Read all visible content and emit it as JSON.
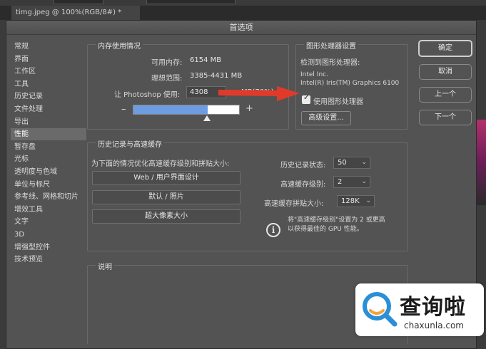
{
  "window": {
    "doc_tab": "timg.jpeg @ 100%(RGB/8#) *",
    "title": "首选项"
  },
  "sidebar": {
    "items": [
      {
        "label": "常规",
        "active": false
      },
      {
        "label": "界面",
        "active": false
      },
      {
        "label": "工作区",
        "active": false
      },
      {
        "label": "工具",
        "active": false
      },
      {
        "label": "历史记录",
        "active": false
      },
      {
        "label": "文件处理",
        "active": false
      },
      {
        "label": "导出",
        "active": false
      },
      {
        "label": "性能",
        "active": true
      },
      {
        "label": "暂存盘",
        "active": false
      },
      {
        "label": "光标",
        "active": false
      },
      {
        "label": "透明度与色域",
        "active": false
      },
      {
        "label": "单位与标尺",
        "active": false
      },
      {
        "label": "参考线、网格和切片",
        "active": false
      },
      {
        "label": "增效工具",
        "active": false
      },
      {
        "label": "文字",
        "active": false
      },
      {
        "label": "3D",
        "active": false
      },
      {
        "label": "增强型控件",
        "active": false
      },
      {
        "label": "技术预览",
        "active": false
      }
    ]
  },
  "memory": {
    "title": "内存使用情况",
    "available_label": "可用内存:",
    "available_value": "6154 MB",
    "range_label": "理想范围:",
    "range_value": "3385-4431 MB",
    "let_label": "让 Photoshop 使用:",
    "use_value": "4308",
    "unit": "MB(70%)",
    "minus": "–",
    "plus": "+",
    "slider_fraction": 0.7
  },
  "gpu": {
    "title": "图形处理器设置",
    "detected_label": "检测到图形处理器:",
    "vendor": "Intel Inc.",
    "model": "Intel(R) Iris(TM) Graphics 6100",
    "use_gpu_label": "使用图形处理器",
    "use_gpu_checked": true,
    "advanced_button": "高级设置..."
  },
  "history": {
    "title": "历史记录与高速缓存",
    "optimize_label": "为下面的情况优化高速缓存级别和拼贴大小:",
    "buttons": [
      "Web / 用户界面设计",
      "默认 / 照片",
      "超大像素大小"
    ],
    "states_label": "历史记录状态:",
    "states_value": "50",
    "cache_levels_label": "高速缓存级别:",
    "cache_levels_value": "2",
    "tile_size_label": "高速缓存拼贴大小:",
    "tile_size_value": "128K",
    "note_line1": "将\"高速缓存级别\"设置为 2 或更高",
    "note_line2": "以获得最佳的 GPU 性能。"
  },
  "description": {
    "title": "说明"
  },
  "actions": {
    "ok": "确定",
    "cancel": "取消",
    "prev": "上一个",
    "next": "下一个"
  },
  "watermark": {
    "name": "查询啦",
    "url": "chaxunla.com"
  },
  "colors": {
    "dialog_bg": "#535353",
    "slider_fill": "#6d9de0",
    "arrow": "#e23a2a",
    "watermark_blue": "#2a8fd6",
    "watermark_orange": "#f3a33a"
  }
}
